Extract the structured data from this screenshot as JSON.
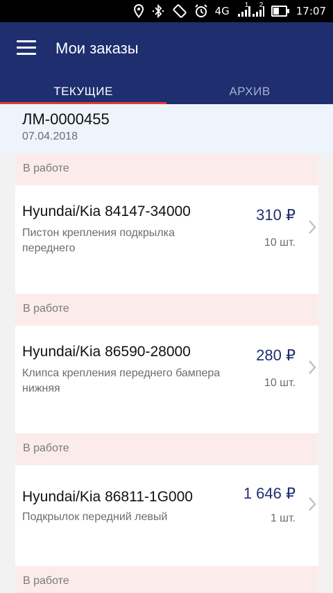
{
  "status_bar": {
    "network": "4G",
    "sim1": "1",
    "sim2": "2",
    "time": "17:07",
    "icons": [
      "location-icon",
      "bluetooth-icon",
      "rotate-icon",
      "alarm-icon",
      "signal-icon",
      "battery-icon"
    ]
  },
  "app_bar": {
    "title": "Мои заказы",
    "tabs": [
      {
        "label": "ТЕКУЩИЕ",
        "active": true
      },
      {
        "label": "АРХИВ",
        "active": false
      }
    ]
  },
  "order": {
    "number": "ЛМ-0000455",
    "date": "07.04.2018"
  },
  "items": [
    {
      "status": "В работе",
      "title": "Hyundai/Kia 84147-34000",
      "description": "Пистон крепления подкрылка переднего",
      "price": "310 ₽",
      "quantity": "10 шт."
    },
    {
      "status": "В работе",
      "title": "Hyundai/Kia 86590-28000",
      "description": "Клипса крепления переднего бампера нижняя",
      "price": "280 ₽",
      "quantity": "10 шт."
    },
    {
      "status": "В работе",
      "title": "Hyundai/Kia 86811-1G000",
      "description": "Подкрылок передний левый",
      "price": "1 646 ₽",
      "quantity": "1 шт."
    },
    {
      "status": "В работе"
    }
  ],
  "colors": {
    "appbar": "#1e2e6f",
    "tab_indicator": "#e23a3a",
    "order_header_bg": "#eef4fb",
    "status_strip_bg": "#fbeceb",
    "price": "#1e2e6f"
  }
}
